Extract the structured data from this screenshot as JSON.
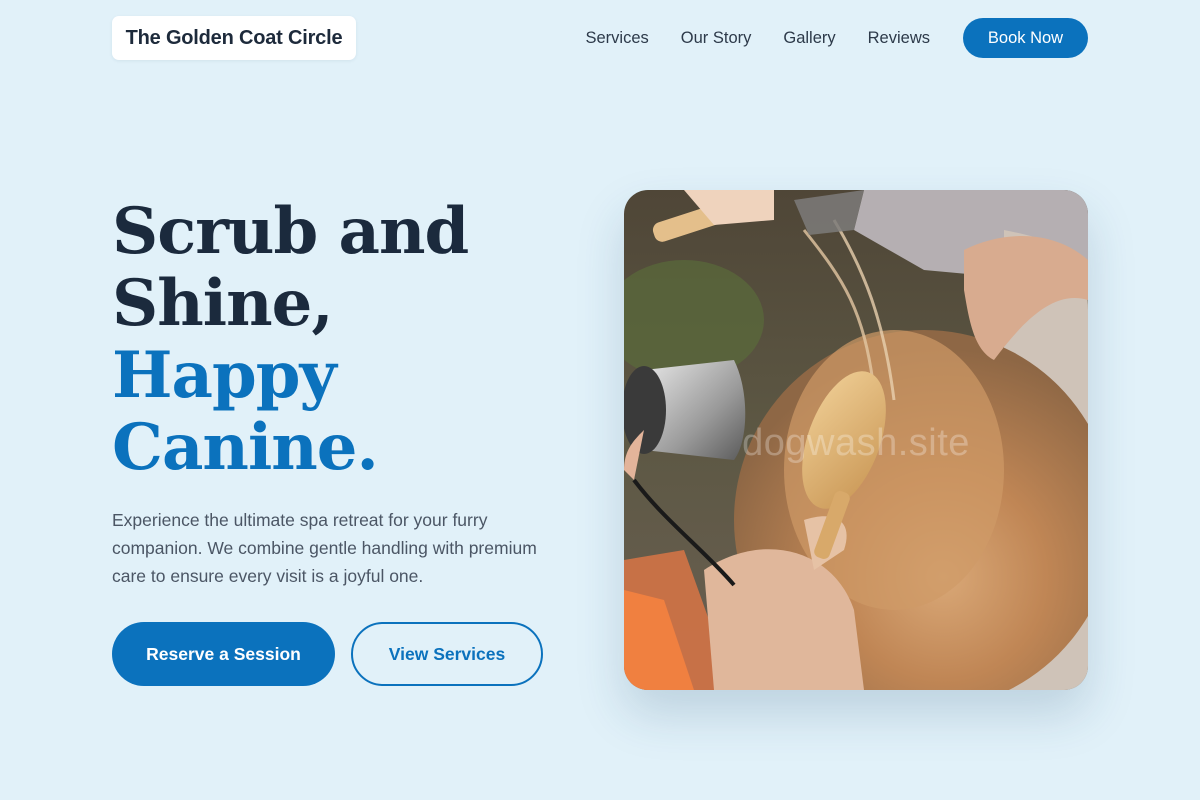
{
  "header": {
    "logo": "The Golden Coat Circle",
    "nav": [
      "Services",
      "Our Story",
      "Gallery",
      "Reviews"
    ],
    "cta": "Book Now"
  },
  "hero": {
    "title_line1": "Scrub and",
    "title_line2": "Shine,",
    "title_accent1": "Happy",
    "title_accent2": "Canine.",
    "description": "Experience the ultimate spa retreat for your furry companion. We combine gentle handling with premium care to ensure every visit is a joyful one.",
    "primary_button": "Reserve a Session",
    "secondary_button": "View Services"
  },
  "image": {
    "watermark": "dogwash.site"
  },
  "colors": {
    "background": "#e1f1f9",
    "accent": "#0b72bd",
    "heading": "#1b2a3d",
    "body_text": "#4b5665"
  }
}
